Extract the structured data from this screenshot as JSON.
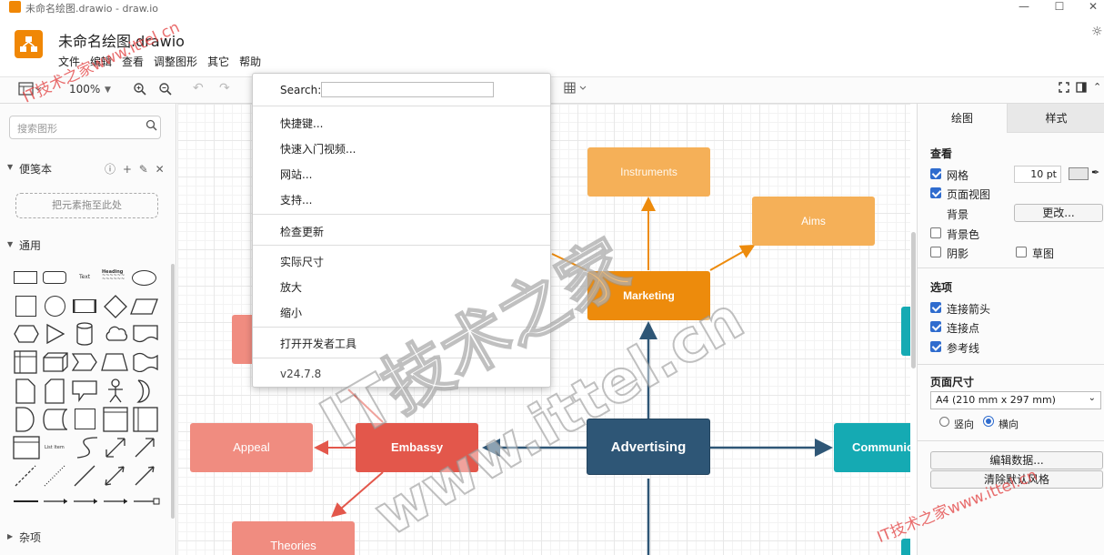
{
  "window": {
    "title": "未命名绘图.drawio - draw.io",
    "minimize": "—",
    "maximize": "☐",
    "close": "✕"
  },
  "app": {
    "doc_title": "未命名绘图.drawio",
    "menus": [
      "文件",
      "编辑",
      "查看",
      "调整图形",
      "其它",
      "帮助"
    ],
    "settings_icon": "gear-icon"
  },
  "toolbar": {
    "zoom": "100%",
    "format_icon": "panel-layout-icon",
    "zoom_in_icon": "zoom-in-icon",
    "zoom_out_icon": "zoom-out-icon",
    "undo_icon": "undo-icon",
    "redo_icon": "redo-icon",
    "table_icon": "table-icon",
    "fullscreen_icon": "fullscreen-icon",
    "sidebar_toggle_icon": "panel-toggle-icon",
    "collapse_icon": "chevron-up-icon"
  },
  "sidebar": {
    "search_placeholder": "搜索图形",
    "scratchpad_title": "便笺本",
    "scratchpad_drop": "把元素拖至此处",
    "general_title": "通用",
    "misc_title": "杂项",
    "text_shape_label": "Text",
    "heading_shape_label": "Heading",
    "list_item_label": "List Item"
  },
  "help_menu": {
    "search_label": "Search:",
    "items": [
      "快捷键...",
      "快速入门视频...",
      "网站...",
      "支持...",
      "检查更新",
      "实际尺寸",
      "放大",
      "缩小",
      "打开开发者工具"
    ],
    "version": "v24.7.8"
  },
  "diagram": {
    "nodes": {
      "instruments": "Instruments",
      "aims": "Aims",
      "marketing": "Marketing",
      "appeal": "Appeal",
      "embassy": "Embassy",
      "advertising": "Advertising",
      "communication": "Communication",
      "theories": "Theories"
    },
    "colors": {
      "orange_light": "#f5b058",
      "orange_dark": "#ed8b0c",
      "red": "#e3574b",
      "salmon": "#f08c80",
      "navy": "#2e5676",
      "teal": "#15aab3"
    }
  },
  "right_panel": {
    "tabs": [
      "绘图",
      "样式"
    ],
    "view_title": "查看",
    "grid_label": "网格",
    "grid_value": "10 pt",
    "page_view_label": "页面视图",
    "background_label": "背景",
    "change_button": "更改...",
    "background_color_label": "背景色",
    "shadow_label": "阴影",
    "sketch_label": "草图",
    "options_title": "选项",
    "connection_arrows_label": "连接箭头",
    "connection_points_label": "连接点",
    "guides_label": "参考线",
    "page_size_title": "页面尺寸",
    "page_size_value": "A4 (210 mm x 297 mm)",
    "portrait_label": "竖向",
    "landscape_label": "横向",
    "edit_data_button": "编辑数据...",
    "clear_style_button": "清除默认风格"
  },
  "watermark": {
    "site_cn": "IT技术之家www.ittel.cn",
    "big": "IT技术之家",
    "url": "www.ittel.cn"
  }
}
